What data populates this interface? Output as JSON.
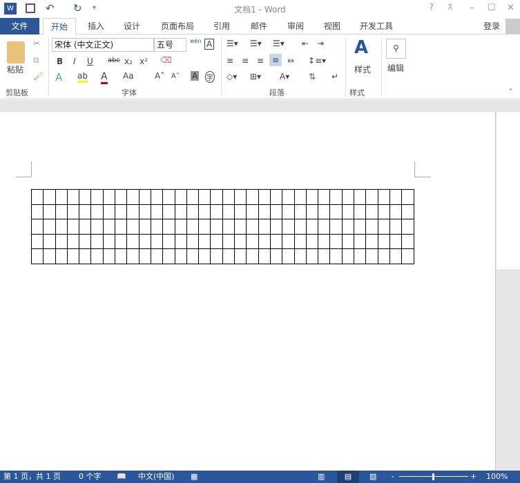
{
  "window": {
    "title": "文档1 - Word",
    "help": "?",
    "minimize": "–",
    "maximize": "☐",
    "close": "✕"
  },
  "quick_access": {
    "undo": "↶",
    "redo": "↻"
  },
  "tabs": [
    "文件",
    "开始",
    "插入",
    "设计",
    "页面布局",
    "引用",
    "邮件",
    "审阅",
    "视图",
    "开发工具"
  ],
  "account": {
    "login": "登录"
  },
  "ribbon": {
    "clipboard": {
      "paste": "粘贴",
      "label": "剪贴板"
    },
    "font": {
      "name": "宋体 (中文正文)",
      "size": "五号",
      "label": "字体",
      "bold": "B",
      "italic": "I",
      "underline": "U",
      "strike": "abc",
      "sub": "x₂",
      "sup": "x²",
      "case": "Aa",
      "grow": "A˄",
      "shrink": "A˅",
      "shade": "A",
      "enclose": "字",
      "phonetic": "wén",
      "border": "A"
    },
    "paragraph": {
      "label": "段落"
    },
    "styles": {
      "button": "样式",
      "label": "样式"
    },
    "editing": {
      "button": "编辑"
    }
  },
  "table": {
    "rows": 5,
    "cols": 32
  },
  "status": {
    "page": "第 1 页，共 1 页",
    "words": "0 个字",
    "language": "中文(中国)",
    "zoom": "100%",
    "zoom_percent": 100
  }
}
